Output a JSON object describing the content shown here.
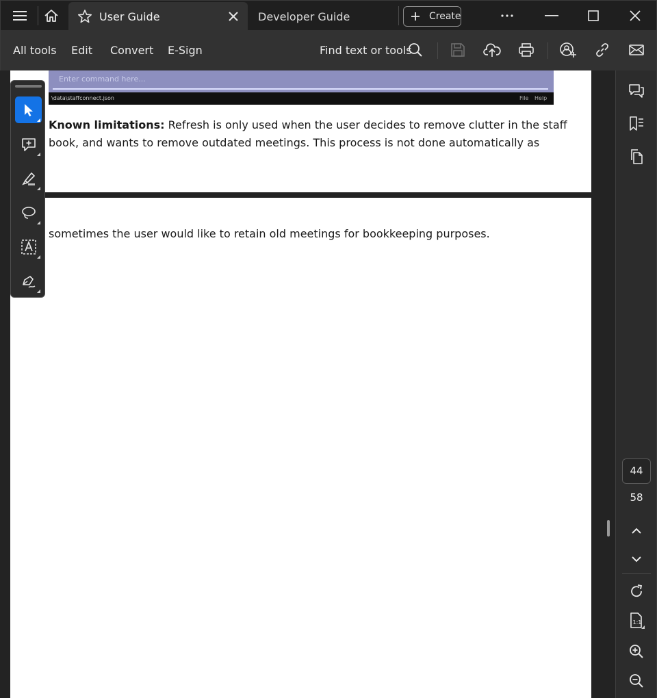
{
  "tabs": [
    {
      "label": "User Guide"
    },
    {
      "label": "Developer Guide"
    }
  ],
  "create_button": {
    "label": "Create"
  },
  "toolbar": {
    "menu": [
      "All tools",
      "Edit",
      "Convert",
      "E-Sign"
    ],
    "search_label": "Find text or tools"
  },
  "document": {
    "embedded_screenshot": {
      "placeholder": "Enter command here...",
      "status_path": "\\data\\staffconnect.json",
      "status_menu": [
        "File",
        "Help"
      ]
    },
    "limitations_heading": "Known limitations:",
    "limitations_line1": " Refresh is only used when the user decides to remove clutter in the staff",
    "limitations_line2": "book, and wants to remove outdated meetings. This process is not done automatically as",
    "page2_line1": "sometimes the user would like to retain old meetings for bookkeeping purposes."
  },
  "pagination": {
    "current": "44",
    "total": "58"
  },
  "colors": {
    "accent": "#1473e6",
    "toolbar_bg": "#323232",
    "window_bg": "#1f1f1f",
    "cmd_area": "#8d8fbf"
  }
}
